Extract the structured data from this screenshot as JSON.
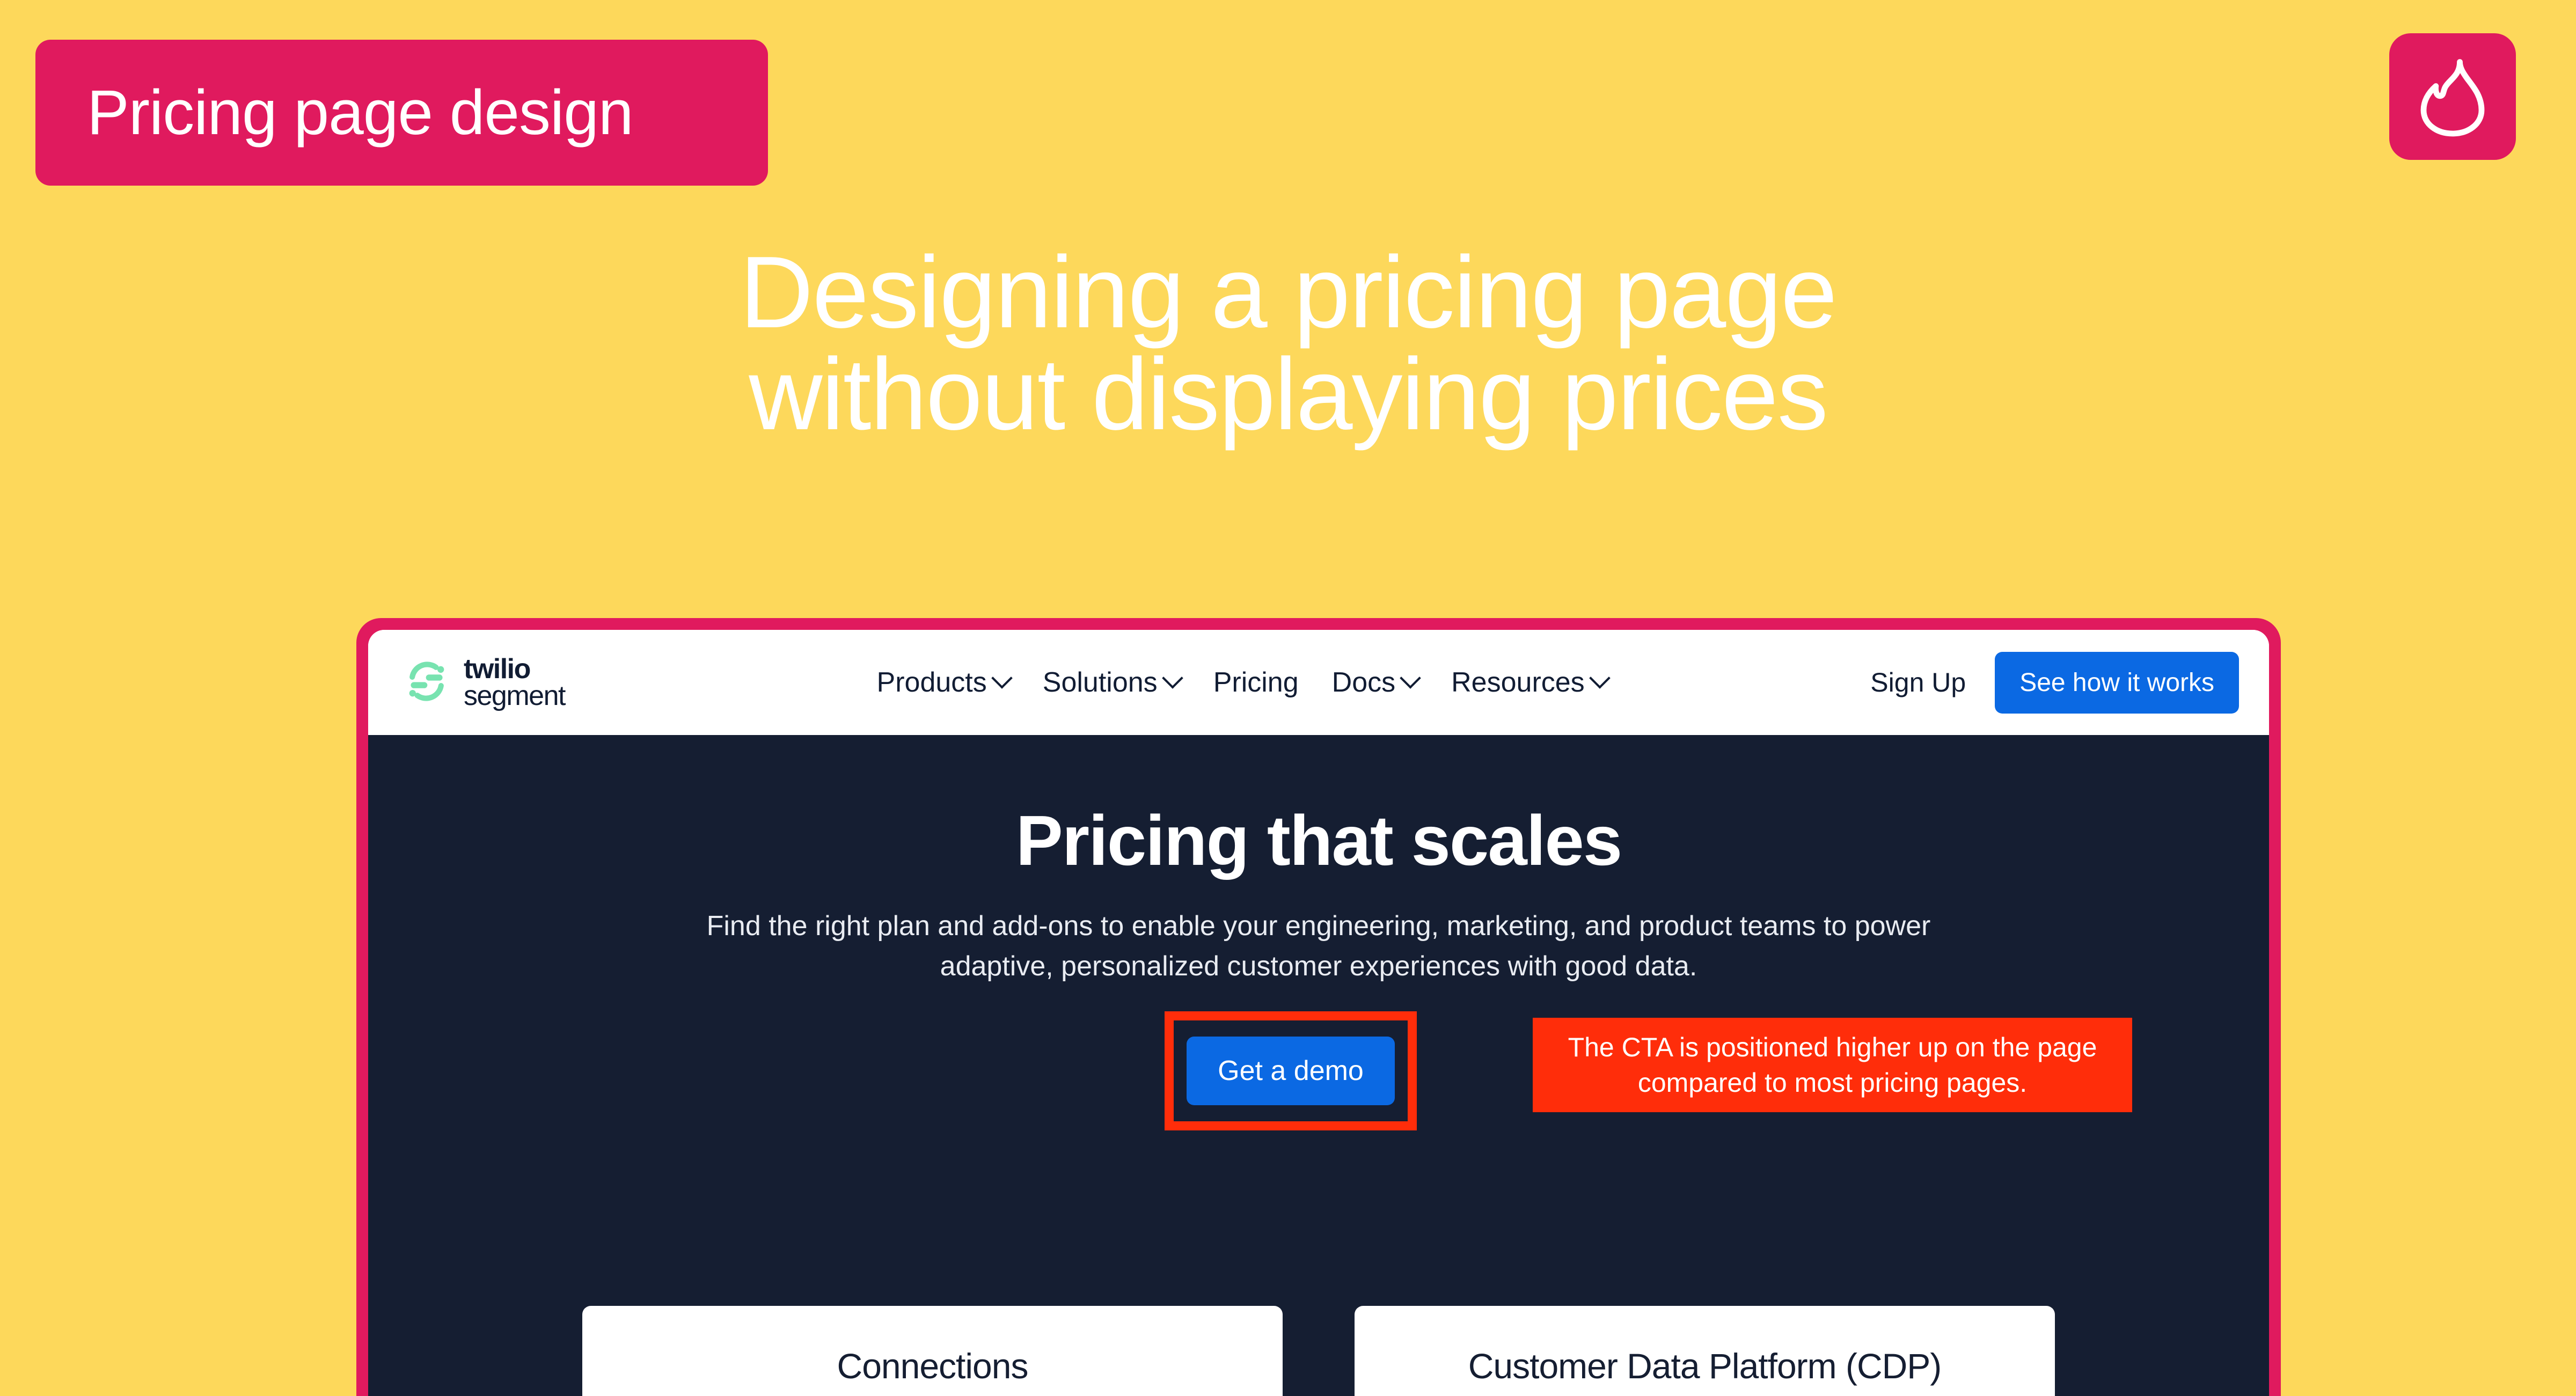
{
  "page": {
    "background_color": "#FDD85B",
    "accent_pink": "#E01A5E",
    "annotation_red": "#FF2D0A",
    "dark_navy": "#151E32",
    "brand_blue": "#0B69E3",
    "segment_green": "#78E3B0"
  },
  "topic_badge": {
    "label": "Pricing page design"
  },
  "brand_logo": {
    "icon": "flame-icon"
  },
  "headline": {
    "line1": "Designing a pricing page",
    "line2": "without displaying prices"
  },
  "browser": {
    "nav": {
      "logo": {
        "mark": "segment-logo-mark",
        "word_top": "twilio",
        "word_bottom": "segment"
      },
      "links": [
        {
          "label": "Products",
          "has_caret": true
        },
        {
          "label": "Solutions",
          "has_caret": true
        },
        {
          "label": "Pricing",
          "has_caret": false
        },
        {
          "label": "Docs",
          "has_caret": true
        },
        {
          "label": "Resources",
          "has_caret": true
        }
      ],
      "signup_label": "Sign Up",
      "cta_label": "See how it works"
    },
    "hero": {
      "title": "Pricing that scales",
      "subtitle_line1": "Find the right plan and add-ons to enable your engineering, marketing, and product teams to power",
      "subtitle_line2": "adaptive, personalized customer experiences with good data.",
      "cta_label": "Get a demo"
    },
    "annotation": {
      "line1": "The CTA is positioned higher up on the page",
      "line2": "compared to most pricing pages."
    },
    "plan_cards": [
      {
        "title": "Connections"
      },
      {
        "title": "Customer Data Platform (CDP)"
      }
    ]
  }
}
